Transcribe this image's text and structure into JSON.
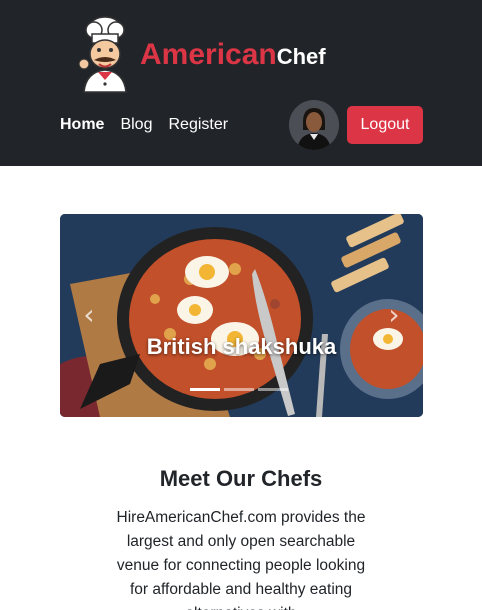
{
  "header": {
    "brand_part1": "American",
    "brand_part2": "Chef",
    "nav": [
      {
        "label": "Home",
        "active": true
      },
      {
        "label": "Blog",
        "active": false
      },
      {
        "label": "Register",
        "active": false
      }
    ],
    "logout_label": "Logout",
    "avatar_icon": "user-avatar",
    "colors": {
      "bar": "#212529",
      "accent": "#dc3545"
    }
  },
  "carousel": {
    "caption": "British shakshuka",
    "slide_count": 3,
    "active_slide": 1,
    "prev_icon": "chevron-left-icon",
    "next_icon": "chevron-right-icon"
  },
  "main": {
    "title": "Meet Our Chefs",
    "body": "HireAmericanChef.com provides the largest and only open searchable venue for connecting people looking for affordable and healthy eating alternatives with"
  }
}
